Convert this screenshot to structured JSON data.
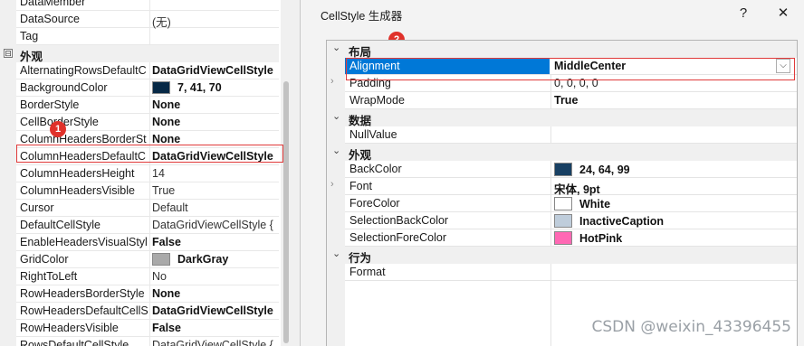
{
  "left_panel": {
    "top_rows": [
      {
        "name": "DataMember",
        "value": ""
      },
      {
        "name": "DataSource",
        "value": "(无)",
        "bold": false
      },
      {
        "name": "Tag",
        "value": "",
        "bold": false
      }
    ],
    "category": {
      "toggle": "⊟",
      "label": "外观"
    },
    "rows": [
      {
        "name": "AlternatingRowsDefaultC",
        "value": "DataGridViewCellStyle",
        "bold": true
      },
      {
        "name": "BackgroundColor",
        "value": "7, 41, 70",
        "bold": true,
        "swatch": "#072946"
      },
      {
        "name": "BorderStyle",
        "value": "None",
        "bold": true
      },
      {
        "name": "CellBorderStyle",
        "value": "None",
        "bold": true
      },
      {
        "name": "ColumnHeadersBorderSt",
        "value": "None",
        "bold": true
      },
      {
        "name": "ColumnHeadersDefaultC",
        "value": "DataGridViewCellStyle",
        "bold": true
      },
      {
        "name": "ColumnHeadersHeight",
        "value": "14",
        "bold": false
      },
      {
        "name": "ColumnHeadersVisible",
        "value": "True",
        "bold": false
      },
      {
        "name": "Cursor",
        "value": "Default",
        "bold": false
      },
      {
        "name": "DefaultCellStyle",
        "value": "DataGridViewCellStyle {",
        "bold": false
      },
      {
        "name": "EnableHeadersVisualStyl",
        "value": "False",
        "bold": true
      },
      {
        "name": "GridColor",
        "value": "DarkGray",
        "bold": true,
        "swatch": "#a9a9a9"
      },
      {
        "name": "RightToLeft",
        "value": "No",
        "bold": false
      },
      {
        "name": "RowHeadersBorderStyle",
        "value": "None",
        "bold": true
      },
      {
        "name": "RowHeadersDefaultCellS",
        "value": "DataGridViewCellStyle",
        "bold": true
      },
      {
        "name": "RowHeadersVisible",
        "value": "False",
        "bold": true
      },
      {
        "name": "RowsDefaultCellStyle",
        "value": "DataGridViewCellStyle {",
        "bold": false
      }
    ],
    "badge1": "1"
  },
  "dialog": {
    "title": "CellStyle 生成器",
    "help_label": "?",
    "close_label": "✕",
    "badge2": "2",
    "categories": [
      {
        "label": "布局",
        "rows": [
          {
            "name": "Alignment",
            "value": "MiddleCenter",
            "bold": true,
            "selected": true
          },
          {
            "name": "Padding",
            "value": "0, 0, 0, 0",
            "bold": false,
            "expandable": true
          },
          {
            "name": "WrapMode",
            "value": "True",
            "bold": true
          }
        ]
      },
      {
        "label": "数据",
        "rows": [
          {
            "name": "NullValue",
            "value": "",
            "bold": false
          }
        ]
      },
      {
        "label": "外观",
        "rows": [
          {
            "name": "BackColor",
            "value": "24, 64, 99",
            "bold": true,
            "swatch": "#184063"
          },
          {
            "name": "Font",
            "value": "宋体, 9pt",
            "bold": true,
            "expandable": true
          },
          {
            "name": "ForeColor",
            "value": "White",
            "bold": true,
            "swatch": "#ffffff"
          },
          {
            "name": "SelectionBackColor",
            "value": "InactiveCaption",
            "bold": true,
            "swatch": "#bfcddb"
          },
          {
            "name": "SelectionForeColor",
            "value": "HotPink",
            "bold": true,
            "swatch": "#ff69b4"
          }
        ]
      },
      {
        "label": "行为",
        "rows": [
          {
            "name": "Format",
            "value": "",
            "bold": false
          }
        ]
      }
    ],
    "dropdown_glyph": "⌵"
  },
  "watermark": "CSDN @weixin_43396455",
  "colors": {
    "selection": "#0078d7",
    "annotation_red": "#e03a3a"
  }
}
